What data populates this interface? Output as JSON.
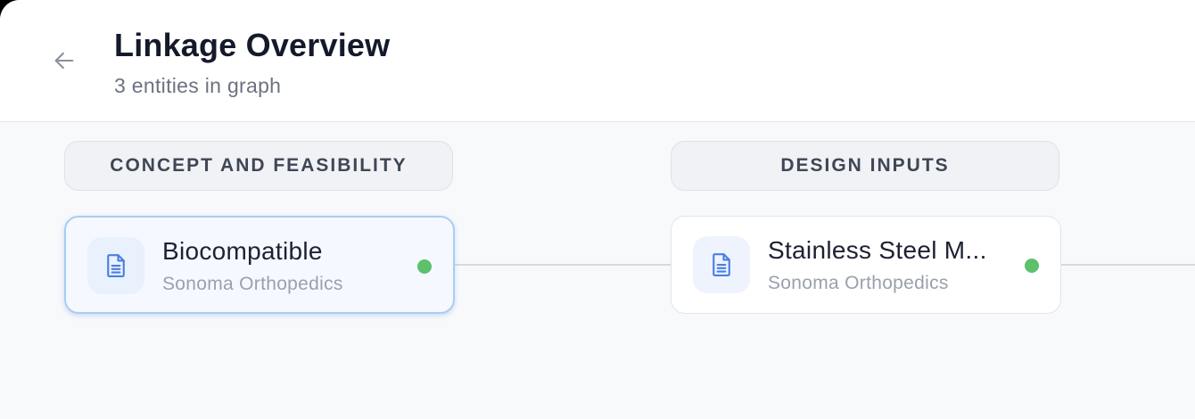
{
  "header": {
    "title": "Linkage Overview",
    "subtitle": "3 entities in graph"
  },
  "stages": [
    {
      "label": "CONCEPT AND FEASIBILITY"
    },
    {
      "label": "DESIGN INPUTS"
    }
  ],
  "cards": [
    {
      "title": "Biocompatible",
      "company": "Sonoma Orthopedics",
      "icon": "document-icon",
      "status": "active",
      "selected": true
    },
    {
      "title": "Stainless Steel M...",
      "company": "Sonoma Orthopedics",
      "icon": "document-icon",
      "status": "active",
      "selected": false
    }
  ],
  "colors": {
    "status_active": "#5cc16a",
    "icon_blue": "#4a7fe0",
    "selected_border": "#a9cdf5"
  }
}
